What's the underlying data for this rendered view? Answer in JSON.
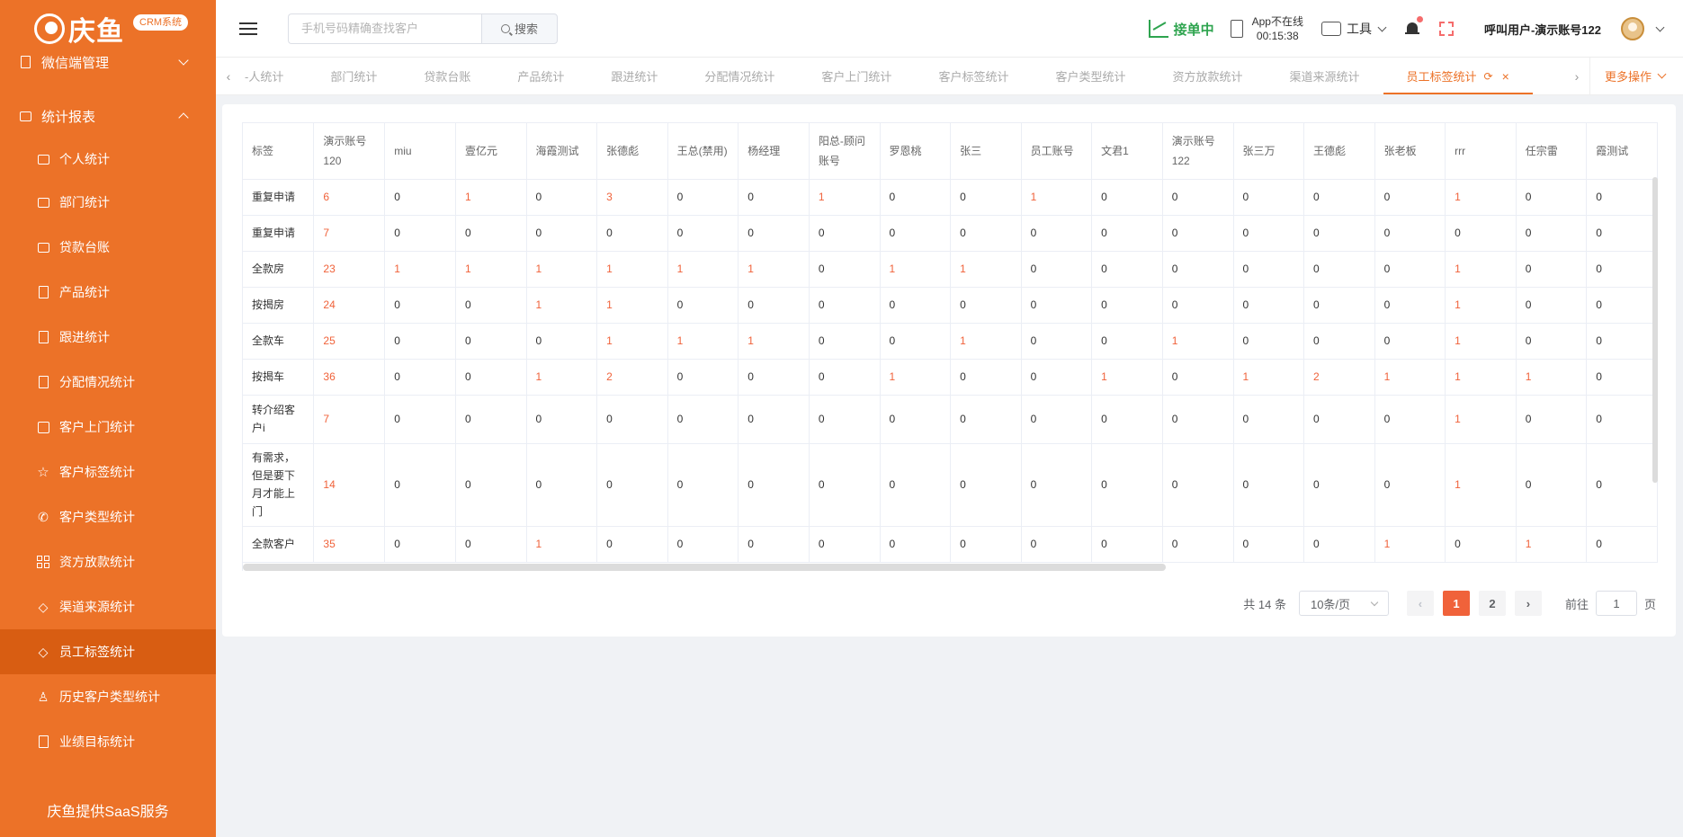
{
  "brand": {
    "name": "庆鱼",
    "badge": "CRM系统"
  },
  "sidebar": {
    "top_item": {
      "label": "微信端管理"
    },
    "group": {
      "label": "统计报表"
    },
    "items": [
      {
        "label": "个人统计",
        "icon": "monitor-icon"
      },
      {
        "label": "部门统计",
        "icon": "monitor-icon"
      },
      {
        "label": "贷款台账",
        "icon": "monitor-icon"
      },
      {
        "label": "产品统计",
        "icon": "document-icon"
      },
      {
        "label": "跟进统计",
        "icon": "edit-icon"
      },
      {
        "label": "分配情况统计",
        "icon": "edit-icon"
      },
      {
        "label": "客户上门统计",
        "icon": "checkbox-icon"
      },
      {
        "label": "客户标签统计",
        "icon": "star-icon"
      },
      {
        "label": "客户类型统计",
        "icon": "phone-icon"
      },
      {
        "label": "资方放款统计",
        "icon": "grid-icon"
      },
      {
        "label": "渠道来源统计",
        "icon": "diamond-icon"
      },
      {
        "label": "员工标签统计",
        "icon": "diamond-icon",
        "active": true
      },
      {
        "label": "历史客户类型统计",
        "icon": "user-icon"
      },
      {
        "label": "业绩目标统计",
        "icon": "edit-icon"
      }
    ],
    "footer": "庆鱼提供SaaS服务"
  },
  "topbar": {
    "search": {
      "placeholder": "手机号码精确查找客户",
      "value": "",
      "button": "搜索"
    },
    "online_status": "接单中",
    "app_status": {
      "line1": "App不在线",
      "line2": "00:15:38"
    },
    "tools_label": "工具",
    "user_name": "呼叫用户-演示账号122"
  },
  "tabs": {
    "items": [
      "个人统计",
      "部门统计",
      "贷款台账",
      "产品统计",
      "跟进统计",
      "分配情况统计",
      "客户上门统计",
      "客户标签统计",
      "客户类型统计",
      "资方放款统计",
      "渠道来源统计",
      "员工标签统计"
    ],
    "first_visible_text": "-人统计",
    "active": "员工标签统计",
    "more": "更多操作"
  },
  "table": {
    "headers": [
      "标签",
      "演示账号120",
      "miu",
      "壹亿元",
      "海霞测试",
      "张德彪",
      "王总(禁用)",
      "杨经理",
      "阳总-顾问账号",
      "罗恩桃",
      "张三",
      "员工账号",
      "文君1",
      "演示账号122",
      "张三万",
      "王德彪",
      "张老板",
      "rrr",
      "任宗雷",
      "霞测试"
    ],
    "rows": [
      {
        "label": "重复申请",
        "values": [
          6,
          0,
          1,
          0,
          3,
          0,
          0,
          1,
          0,
          0,
          1,
          0,
          0,
          0,
          0,
          0,
          1,
          0,
          0
        ]
      },
      {
        "label": "重复申请",
        "values": [
          7,
          0,
          0,
          0,
          0,
          0,
          0,
          0,
          0,
          0,
          0,
          0,
          0,
          0,
          0,
          0,
          0,
          0,
          0
        ]
      },
      {
        "label": "全款房",
        "values": [
          23,
          1,
          1,
          1,
          1,
          1,
          1,
          0,
          1,
          1,
          0,
          0,
          0,
          0,
          0,
          0,
          1,
          0,
          0
        ]
      },
      {
        "label": "按揭房",
        "values": [
          24,
          0,
          0,
          1,
          1,
          0,
          0,
          0,
          0,
          0,
          0,
          0,
          0,
          0,
          0,
          0,
          1,
          0,
          0
        ]
      },
      {
        "label": "全款车",
        "values": [
          25,
          0,
          0,
          0,
          1,
          1,
          1,
          0,
          0,
          1,
          0,
          0,
          1,
          0,
          0,
          0,
          1,
          0,
          0
        ]
      },
      {
        "label": "按揭车",
        "values": [
          36,
          0,
          0,
          1,
          2,
          0,
          0,
          0,
          1,
          0,
          0,
          1,
          0,
          1,
          2,
          1,
          1,
          1,
          0
        ]
      },
      {
        "label": "转介绍客户i",
        "values": [
          7,
          0,
          0,
          0,
          0,
          0,
          0,
          0,
          0,
          0,
          0,
          0,
          0,
          0,
          0,
          0,
          1,
          0,
          0
        ]
      },
      {
        "label": "有需求，但是要下月才能上门",
        "values": [
          14,
          0,
          0,
          0,
          0,
          0,
          0,
          0,
          0,
          0,
          0,
          0,
          0,
          0,
          0,
          0,
          1,
          0,
          0
        ]
      },
      {
        "label": "全款客户",
        "values": [
          35,
          0,
          0,
          1,
          0,
          0,
          0,
          0,
          0,
          0,
          0,
          0,
          0,
          0,
          0,
          1,
          0,
          1,
          0
        ]
      }
    ]
  },
  "pagination": {
    "total": "共 14 条",
    "page_size": "10条/页",
    "pages": [
      "1",
      "2"
    ],
    "current": "1",
    "goto_label": "前往",
    "goto_value": "1",
    "page_suffix": "页"
  },
  "colors": {
    "brand": "#ec7228",
    "active_menu": "#d85d12",
    "highlight": "#f0623a",
    "online": "#2ea44f"
  }
}
